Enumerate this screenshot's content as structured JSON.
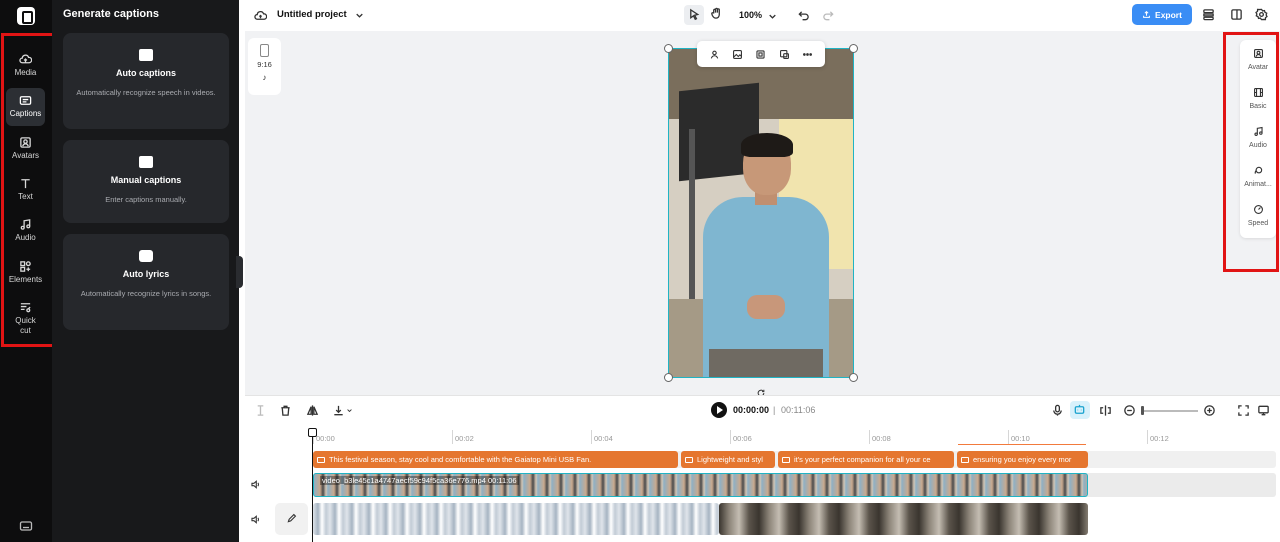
{
  "app": {
    "project_title": "Untitled project",
    "zoom": "100%",
    "export_label": "Export"
  },
  "rail": {
    "items": [
      {
        "label": "Media",
        "icon": "cloud-upload-icon"
      },
      {
        "label": "Captions",
        "icon": "captions-icon"
      },
      {
        "label": "Avatars",
        "icon": "avatar-icon"
      },
      {
        "label": "Text",
        "icon": "text-icon"
      },
      {
        "label": "Audio",
        "icon": "music-note-icon"
      },
      {
        "label": "Elements",
        "icon": "elements-icon"
      },
      {
        "label": "Quick cut",
        "icon": "quick-cut-icon"
      }
    ]
  },
  "panel": {
    "title": "Generate captions",
    "cards": [
      {
        "title": "Auto captions",
        "desc": "Automatically recognize speech in videos."
      },
      {
        "title": "Manual captions",
        "desc": "Enter captions manually."
      },
      {
        "title": "Auto lyrics",
        "desc": "Automatically recognize lyrics in songs."
      }
    ]
  },
  "canvas": {
    "ratio": "9:16",
    "platform_glyph": "♪"
  },
  "right_panel": {
    "items": [
      {
        "label": "Avatar"
      },
      {
        "label": "Basic"
      },
      {
        "label": "Audio"
      },
      {
        "label": "Animat..."
      },
      {
        "label": "Speed"
      }
    ]
  },
  "playback": {
    "current": "00:00:00",
    "separator": "|",
    "total": "00:11:06"
  },
  "timeline": {
    "ruler": [
      "00:00",
      "00:02",
      "00:04",
      "00:06",
      "00:08",
      "00:10",
      "00:12"
    ],
    "captions": [
      "This festival season, stay cool and comfortable with the Gaiatop Mini USB Fan.",
      "Lightweight and styl",
      "it's your perfect companion for all your ce",
      "ensuring you enjoy every mor"
    ],
    "main_clip_label": "video_b3le45c1a4747aecf59c94f5ca36e776.mp4   00:11:06"
  },
  "colors": {
    "accent": "#3a8df5",
    "caption_track": "#e5762f",
    "selection": "#20b4c4",
    "highlight_box": "#e11414"
  }
}
